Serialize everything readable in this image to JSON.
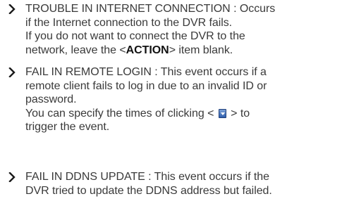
{
  "items": [
    {
      "line1": "TROUBLE IN INTERNET CONNECTION : Occurs",
      "line2": "if the Internet connection to the DVR fails.",
      "line3": "If you do not want to connect the DVR to the",
      "line4_before": "network, leave the <",
      "line4_bold": "ACTION",
      "line4_after": "> item blank."
    },
    {
      "line1": "FAIL IN REMOTE LOGIN : This event occurs if a",
      "line2": "remote client fails to log in due to an invalid ID or",
      "line3": "password.",
      "line4_before": "You can specify the times of clicking < ",
      "line4_after": " > to",
      "line5": "trigger the event."
    },
    {
      "line1": "FAIL IN DDNS UPDATE : This event occurs if the",
      "line2": "DVR tried to update the DDNS address but failed."
    }
  ],
  "icons": {
    "bullet": "chevron-right-icon",
    "spin": "spin-down-button-icon"
  },
  "colors": {
    "text": "#3a3a3a",
    "bold_text": "#111111",
    "icon_blue": "#2f5fae"
  }
}
